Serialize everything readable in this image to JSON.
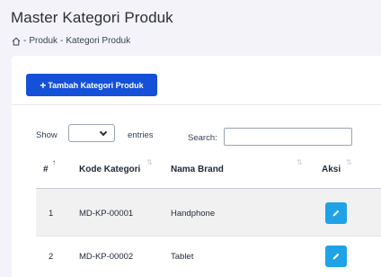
{
  "page": {
    "title": "Master Kategori Produk",
    "breadcrumb": {
      "sep1": "-",
      "level1": "Produk",
      "sep2": "-",
      "level2": "Kategori Produk"
    }
  },
  "toolbar": {
    "add_button_label": "Tambah Kategori Produk",
    "add_button_icon": "+"
  },
  "table_controls": {
    "show_label": "Show",
    "entries_label": "entries",
    "entries_selected": "",
    "search_label": "Search:",
    "search_value": ""
  },
  "table": {
    "columns": [
      {
        "label": "#"
      },
      {
        "label": "Kode Kategori"
      },
      {
        "label": "Nama Brand"
      },
      {
        "label": "Aksi"
      }
    ],
    "rows": [
      {
        "no": "1",
        "kode": "MD-KP-00001",
        "nama": "Handphone"
      },
      {
        "no": "2",
        "kode": "MD-KP-00002",
        "nama": "Tablet"
      }
    ]
  },
  "colors": {
    "primary": "#1450d8",
    "edit": "#1fa2e6",
    "background": "#f3f3f9"
  },
  "icons": {
    "home": "home-icon",
    "edit": "pencil-icon",
    "chevron": "chevron-down-icon"
  }
}
